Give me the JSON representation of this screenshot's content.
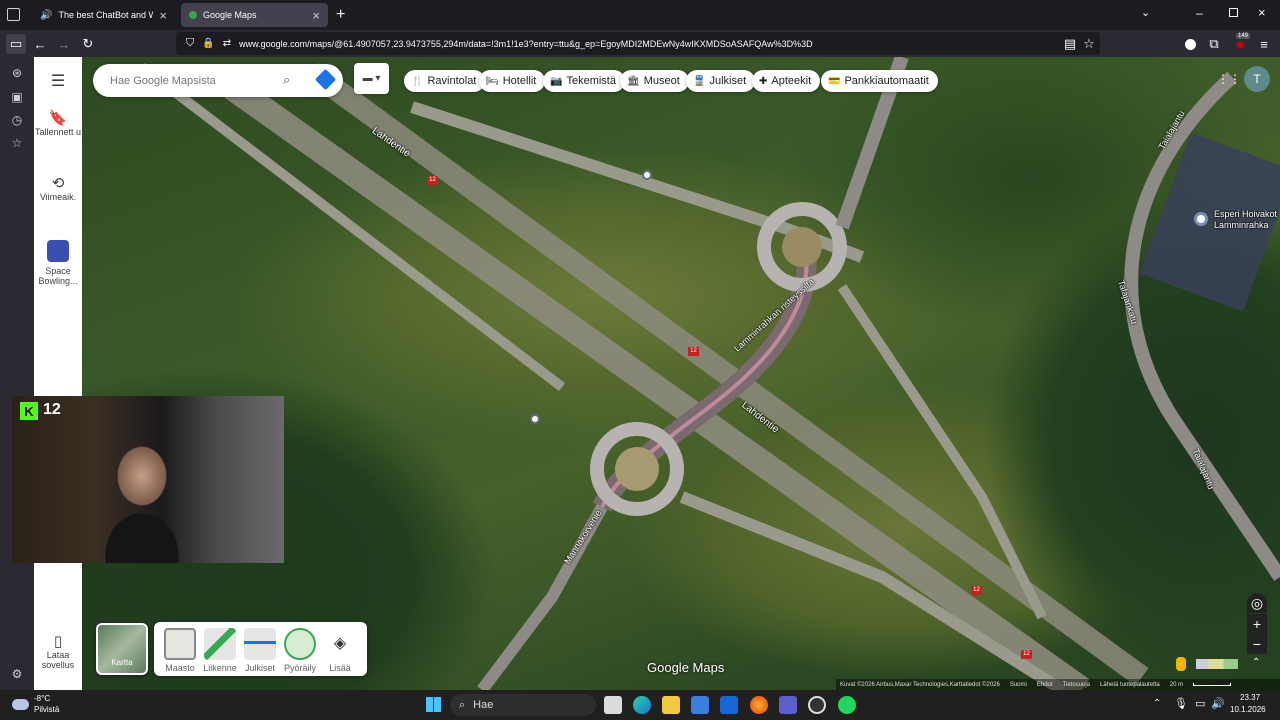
{
  "browser": {
    "tabs": [
      {
        "title": "The best ChatBot and Widg",
        "active": false
      },
      {
        "title": "Google Maps",
        "active": true
      }
    ],
    "new_tab": "+",
    "url": "www.google.com/maps/@61.4907057,23.9473755,294m/data=!3m1!1e3?entry=ttu&g_ep=EgoyMDI2MDEwNy4wIKXMDSoASAFQAw%3D%3D",
    "extension_badge": "149"
  },
  "maps": {
    "rail": {
      "saved": "Tallennett u",
      "recent": "Viimeaik.",
      "pinned": "Space Bowling...",
      "download_app": "Lataa sovellus"
    },
    "search_placeholder": "Hae Google Mapsista",
    "chips": [
      "Ravintolat",
      "Hotellit",
      "Tekemistä",
      "Museot",
      "Julkiset",
      "Apteekit",
      "Pankkiautomaatit"
    ],
    "chip_icons": [
      "fork-knife-icon",
      "bed-icon",
      "camera-icon",
      "museum-icon",
      "transit-icon",
      "pharmacy-icon",
      "atm-icon"
    ],
    "layers": {
      "current": "Kartta",
      "options": [
        "Maasto",
        "Liikenne",
        "Julkiset",
        "Pyöräily",
        "Lisää"
      ]
    },
    "labels": {
      "road1": "Lahdentie",
      "road2": "Lahdentie",
      "road3": "Lamminrahkan risteyssilta",
      "road4": "Mannakorvenie",
      "road5": "Taialajantu",
      "road6": "Talajankatu",
      "road7": "Taialajantu",
      "place": "Esperi Hoivakot Lamminrahka",
      "shield": "12"
    },
    "logo": "Google Maps",
    "attribution": [
      "Kuvat ©2026 Airbus,Maxar Technologies,Karttatiedot ©2026",
      "Suomi",
      "Ehdot",
      "Tietosuoja",
      "Lähetä tuotepalautetta",
      "20 m"
    ],
    "avatar_letter": "T"
  },
  "overlay": {
    "channel_badge": "12"
  },
  "taskbar": {
    "weather_temp": "-8°C",
    "weather_desc": "Pilvistä",
    "search": "Hae",
    "time": "23.37",
    "date": "10.1.2026"
  }
}
